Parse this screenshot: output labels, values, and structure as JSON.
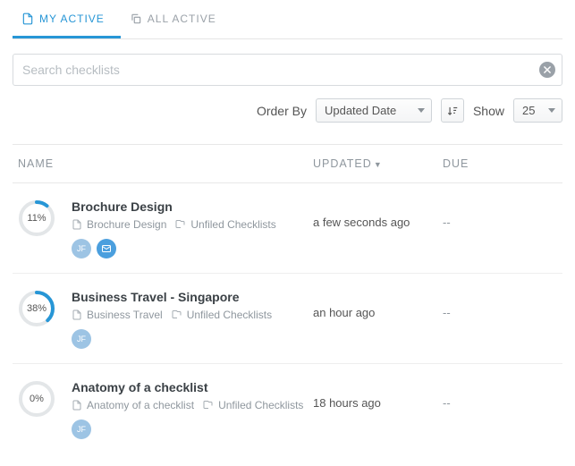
{
  "tabs": {
    "my_active": "MY ACTIVE",
    "all_active": "ALL ACTIVE"
  },
  "search": {
    "placeholder": "Search checklists",
    "value": ""
  },
  "controls": {
    "orderby_label": "Order By",
    "orderby_value": "Updated Date",
    "show_label": "Show",
    "show_value": "25"
  },
  "columns": {
    "name": "NAME",
    "updated": "UPDATED",
    "due": "DUE"
  },
  "colors": {
    "accent": "#2796d6",
    "ring_bg": "#e3e6e8"
  },
  "rows": [
    {
      "percent": 11,
      "title": "Brochure Design",
      "template": "Brochure Design",
      "folder": "Unfiled Checklists",
      "updated": "a few seconds ago",
      "due": "--",
      "badges": [
        {
          "type": "avatar",
          "label": "JF"
        },
        {
          "type": "mail",
          "label": "mail"
        }
      ]
    },
    {
      "percent": 38,
      "title": "Business Travel - Singapore",
      "template": "Business Travel",
      "folder": "Unfiled Checklists",
      "updated": "an hour ago",
      "due": "--",
      "badges": [
        {
          "type": "avatar",
          "label": "JF"
        }
      ]
    },
    {
      "percent": 0,
      "title": "Anatomy of a checklist",
      "template": "Anatomy of a checklist",
      "folder": "Unfiled Checklists",
      "updated": "18 hours ago",
      "due": "--",
      "badges": [
        {
          "type": "avatar",
          "label": "JF"
        }
      ]
    }
  ]
}
